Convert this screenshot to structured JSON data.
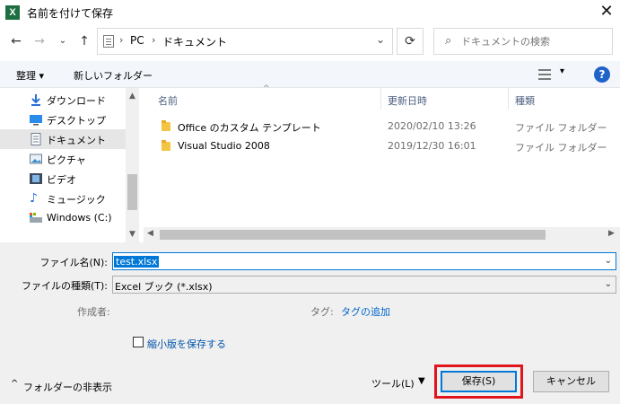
{
  "window": {
    "title": "名前を付けて保存",
    "app_icon_letter": "X",
    "close_glyph": "✕"
  },
  "address": {
    "crumbs": [
      "PC",
      "ドキュメント"
    ],
    "search_placeholder": "ドキュメントの検索"
  },
  "toolbar": {
    "organize_label": "整理 ▾",
    "new_folder_label": "新しいフォルダー",
    "help_label": "?"
  },
  "nav": {
    "items": [
      {
        "label": "ダウンロード",
        "icon": "download-icon"
      },
      {
        "label": "デスクトップ",
        "icon": "desktop-icon"
      },
      {
        "label": "ドキュメント",
        "icon": "document-icon"
      },
      {
        "label": "ピクチャ",
        "icon": "pictures-icon"
      },
      {
        "label": "ビデオ",
        "icon": "video-icon"
      },
      {
        "label": "ミュージック",
        "icon": "music-icon"
      },
      {
        "label": "Windows (C:)",
        "icon": "drive-icon"
      }
    ]
  },
  "list": {
    "headers": [
      "名前",
      "更新日時",
      "種類"
    ],
    "rows": [
      {
        "name": "Office のカスタム テンプレート",
        "date": "2020/02/10 13:26",
        "type": "ファイル フォルダー"
      },
      {
        "name": "Visual Studio 2008",
        "date": "2019/12/30 16:01",
        "type": "ファイル フォルダー"
      }
    ]
  },
  "form": {
    "filename_label": "ファイル名(N):",
    "filename_value": "test.xlsx",
    "filetype_label": "ファイルの種類(T):",
    "filetype_value": "Excel ブック (*.xlsx)",
    "author_label": "作成者:",
    "tag_label": "タグ:",
    "tag_link": "タグの追加",
    "thumbnail_label": "縮小版を保存する",
    "hide_folders_label": "フォルダーの非表示",
    "tools_label": "ツール(L)",
    "save_label": "保存(S)",
    "cancel_label": "キャンセル"
  },
  "colors": {
    "accent": "#0078d7",
    "highlight_box": "#e0161e",
    "excel_green": "#1d6f42"
  }
}
